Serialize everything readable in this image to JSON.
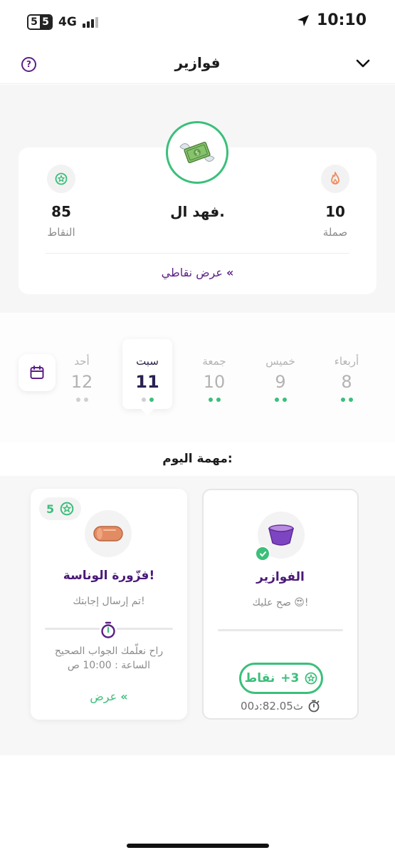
{
  "status_bar": {
    "sim_badge": [
      "5",
      "5"
    ],
    "network": "4G",
    "time": "10:10"
  },
  "nav": {
    "title": "فوازير",
    "help_icon": "?"
  },
  "profile": {
    "name": "فهد ال.",
    "points_value": "85",
    "points_label": "النقاط",
    "streak_value": "10",
    "streak_label": "صملة",
    "view_points_label": "عرض نقاطي",
    "view_points_arrow": "«"
  },
  "days": [
    {
      "name": "أحد",
      "num": "12",
      "dots": [
        "grey",
        "grey"
      ]
    },
    {
      "name": "سبت",
      "num": "11",
      "dots": [
        "grey",
        "green"
      ],
      "selected": true
    },
    {
      "name": "جمعة",
      "num": "10",
      "dots": [
        "green",
        "green"
      ]
    },
    {
      "name": "خميس",
      "num": "9",
      "dots": [
        "green",
        "green"
      ]
    },
    {
      "name": "أربعاء",
      "num": "8",
      "dots": [
        "green",
        "green"
      ]
    }
  ],
  "today": {
    "title": "مهمة اليوم:"
  },
  "tasks": {
    "done": {
      "name": "الفوازير",
      "subtitle": "صح عليك 😍!",
      "points_label": "نقاط",
      "points_value": "+3",
      "time_taken": "ث82.05:د00"
    },
    "pending": {
      "name": "فزّورة الوناسة!",
      "subtitle": "تم إرسال إجابتك!",
      "reveal_line1": "راح نعلّمك الجواب الصحيح",
      "reveal_line2": "الساعة : 10:00 ص",
      "view_label": "عرض",
      "view_arrow": "«",
      "score": "5"
    }
  },
  "colors": {
    "accent_green": "#3bbf7a",
    "accent_purple": "#5b1f86",
    "flame": "#f08a5d"
  }
}
